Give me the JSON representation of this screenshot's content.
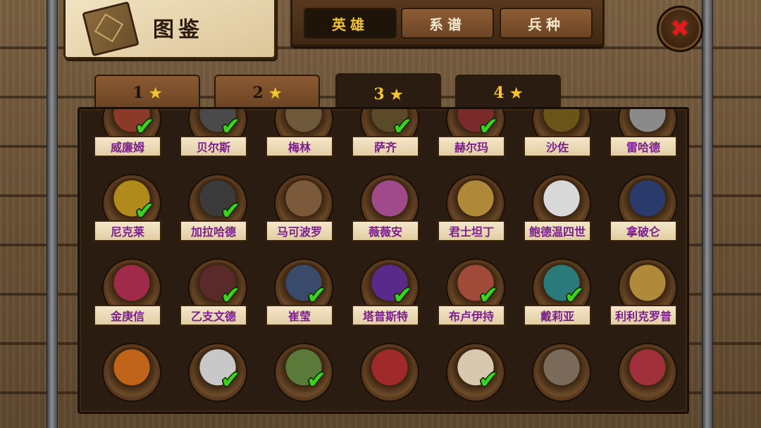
{
  "title": {
    "text": "图鉴",
    "icon": "book-icon"
  },
  "top_tabs": [
    {
      "label": "英雄",
      "active": true
    },
    {
      "label": "系谱",
      "active": false
    },
    {
      "label": "兵种",
      "active": false
    }
  ],
  "close_icon": "close-icon",
  "star_tabs": [
    {
      "label": "1",
      "active": false
    },
    {
      "label": "2",
      "active": false
    },
    {
      "label": "3",
      "active": true
    },
    {
      "label": "4",
      "active": false
    }
  ],
  "star_glyph": "★",
  "check_glyph": "✔",
  "close_glyph": "✖",
  "colors": {
    "accent_gold": "#f2c32e",
    "name_purple": "#7a1f8c",
    "check_green": "#3ed11f",
    "close_red": "#e01b1b"
  },
  "heroes": [
    {
      "name": "威廉姆",
      "owned": true,
      "color": "#8b3a2a"
    },
    {
      "name": "贝尔斯",
      "owned": true,
      "color": "#4a4a4a"
    },
    {
      "name": "梅林",
      "owned": false,
      "color": "#6e5a3a"
    },
    {
      "name": "萨齐",
      "owned": true,
      "color": "#5b4a2a"
    },
    {
      "name": "赫尔玛",
      "owned": true,
      "color": "#7a2a2a"
    },
    {
      "name": "沙佐",
      "owned": false,
      "color": "#6a5418"
    },
    {
      "name": "雷哈德",
      "owned": false,
      "color": "#8a8a8a"
    },
    {
      "name": "尼克莱",
      "owned": true,
      "color": "#b08a1a"
    },
    {
      "name": "加拉哈德",
      "owned": true,
      "color": "#3a3a3a"
    },
    {
      "name": "马可波罗",
      "owned": false,
      "color": "#7a5a3a"
    },
    {
      "name": "薇薇安",
      "owned": false,
      "color": "#a04a8a"
    },
    {
      "name": "君士坦丁",
      "owned": false,
      "color": "#b0883a"
    },
    {
      "name": "鲍德温四世",
      "owned": false,
      "color": "#d8d8d8"
    },
    {
      "name": "拿破仑",
      "owned": false,
      "color": "#2a3a6a"
    },
    {
      "name": "金庚信",
      "owned": false,
      "color": "#a02a4a"
    },
    {
      "name": "乙支文德",
      "owned": true,
      "color": "#5a2a2a"
    },
    {
      "name": "崔莹",
      "owned": true,
      "color": "#3a4a6a"
    },
    {
      "name": "塔普斯特",
      "owned": true,
      "color": "#5a2a8a"
    },
    {
      "name": "布卢伊持",
      "owned": true,
      "color": "#a04a3a"
    },
    {
      "name": "戴莉亚",
      "owned": true,
      "color": "#2a7a7a"
    },
    {
      "name": "利利克罗普",
      "owned": false,
      "color": "#b08a3a"
    },
    {
      "name": "",
      "owned": false,
      "color": "#c0641a"
    },
    {
      "name": "",
      "owned": true,
      "color": "#c8c8c8"
    },
    {
      "name": "",
      "owned": true,
      "color": "#5a7a3a"
    },
    {
      "name": "",
      "owned": false,
      "color": "#a02a2a"
    },
    {
      "name": "",
      "owned": true,
      "color": "#d8c8b0"
    },
    {
      "name": "",
      "owned": false,
      "color": "#7a6a5a"
    },
    {
      "name": "",
      "owned": false,
      "color": "#a0303a"
    }
  ]
}
